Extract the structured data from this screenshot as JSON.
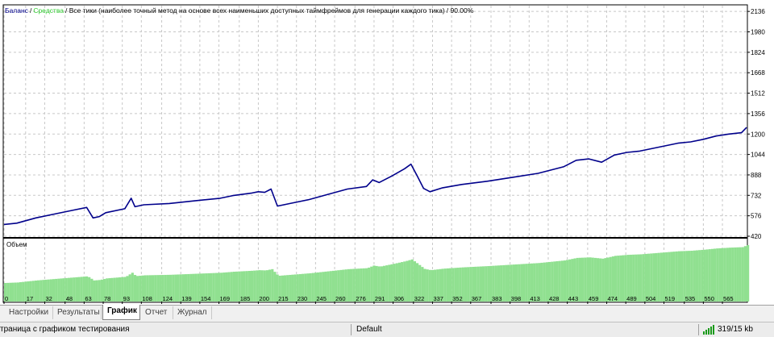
{
  "header": {
    "balance_label": "Баланс",
    "divider": "/",
    "equity_label": "Средства",
    "info_text": "/ Все тики (наиболее точный метод на основе всех наименьших доступных таймфреймов для генерации каждого тика)",
    "quality": "/ 90.00%"
  },
  "volume_label": "Объем",
  "tabs": [
    {
      "label": "Настройки",
      "active": false
    },
    {
      "label": "Результаты",
      "active": false
    },
    {
      "label": "График",
      "active": true
    },
    {
      "label": "Отчет",
      "active": false
    },
    {
      "label": "Журнал",
      "active": false
    }
  ],
  "status": {
    "description": "траница с графиком тестирования",
    "profile": "Default",
    "traffic": "319/15 kb"
  },
  "colors": {
    "balance": "#00008b",
    "equity": "#32cd32",
    "volume": "#90e090",
    "grid": "#c8c8c8"
  },
  "chart_data": [
    {
      "type": "line",
      "y_ticks": [
        420,
        576,
        732,
        888,
        1044,
        1200,
        1356,
        1512,
        1668,
        1824,
        1980,
        2136
      ],
      "x_ticks": [
        0,
        17,
        32,
        48,
        63,
        78,
        93,
        108,
        124,
        139,
        154,
        169,
        185,
        200,
        215,
        230,
        245,
        260,
        276,
        291,
        306,
        322,
        337,
        352,
        367,
        383,
        398,
        413,
        428,
        443,
        459,
        474,
        489,
        504,
        519,
        535,
        550,
        565
      ],
      "xlim": [
        0,
        584
      ],
      "ylim": [
        420,
        2180
      ],
      "grid": true,
      "series": [
        {
          "name": "Баланс",
          "x": [
            0,
            10,
            25,
            40,
            55,
            65,
            70,
            75,
            80,
            95,
            100,
            103,
            110,
            130,
            150,
            170,
            180,
            195,
            200,
            205,
            210,
            215,
            225,
            240,
            255,
            270,
            285,
            290,
            295,
            305,
            315,
            320,
            325,
            330,
            335,
            345,
            360,
            380,
            400,
            420,
            440,
            450,
            460,
            470,
            480,
            490,
            500,
            510,
            520,
            530,
            540,
            550,
            560,
            570,
            580,
            584
          ],
          "y": [
            510,
            520,
            560,
            590,
            620,
            640,
            560,
            570,
            600,
            630,
            710,
            645,
            660,
            670,
            690,
            710,
            730,
            750,
            760,
            755,
            780,
            650,
            670,
            700,
            740,
            780,
            800,
            850,
            830,
            880,
            935,
            970,
            880,
            785,
            760,
            790,
            815,
            840,
            870,
            900,
            950,
            1000,
            1010,
            985,
            1040,
            1060,
            1070,
            1090,
            1110,
            1130,
            1140,
            1160,
            1185,
            1200,
            1210,
            1250
          ]
        }
      ]
    },
    {
      "type": "bar",
      "ylabel": "Объем",
      "grid": true
    }
  ]
}
